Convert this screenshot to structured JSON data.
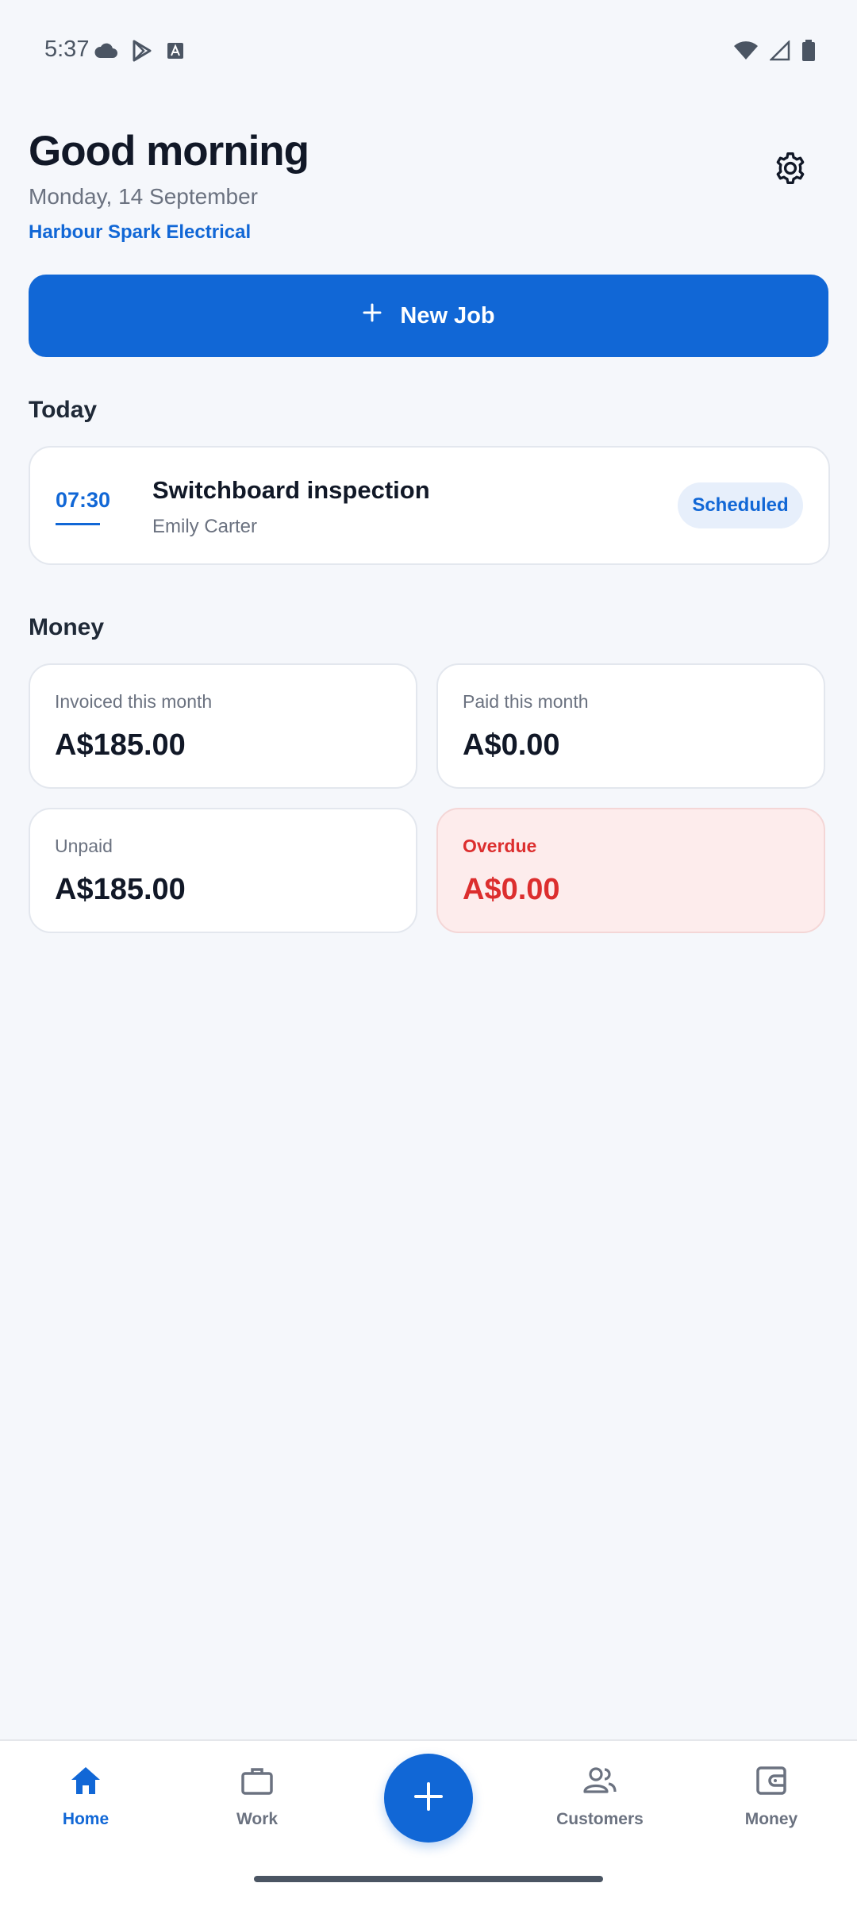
{
  "status_bar": {
    "time": "5:37",
    "left_icons": [
      "cloud-icon",
      "play-store-icon",
      "font-icon"
    ],
    "right_icons": [
      "wifi-icon",
      "cellular-icon",
      "battery-icon"
    ]
  },
  "header": {
    "greeting": "Good morning",
    "date": "Monday, 14 September",
    "business_name": "Harbour Spark Electrical",
    "settings_icon": "gear-icon"
  },
  "new_job_button": {
    "icon": "plus-icon",
    "label": "New Job"
  },
  "today": {
    "title": "Today",
    "jobs": [
      {
        "time": "07:30",
        "title": "Switchboard inspection",
        "customer": "Emily Carter",
        "status": "Scheduled"
      }
    ]
  },
  "money": {
    "title": "Money",
    "cards": [
      {
        "label": "Invoiced this month",
        "value": "A$185.00"
      },
      {
        "label": "Paid this month",
        "value": "A$0.00"
      },
      {
        "label": "Unpaid",
        "value": "A$185.00"
      },
      {
        "label": "Overdue",
        "value": "A$0.00"
      }
    ]
  },
  "bottom_nav": {
    "items": [
      {
        "label": "Home",
        "icon": "home-icon",
        "active": true
      },
      {
        "label": "Work",
        "icon": "briefcase-icon",
        "active": false
      },
      {
        "label": "Customers",
        "icon": "people-icon",
        "active": false
      },
      {
        "label": "Money",
        "icon": "wallet-icon",
        "active": false
      }
    ],
    "fab_icon": "plus-icon"
  },
  "colors": {
    "accent": "#1167d6",
    "background": "#f5f7fb",
    "overdue": "#dc2e2e",
    "overdue_bg": "#fdecec"
  }
}
